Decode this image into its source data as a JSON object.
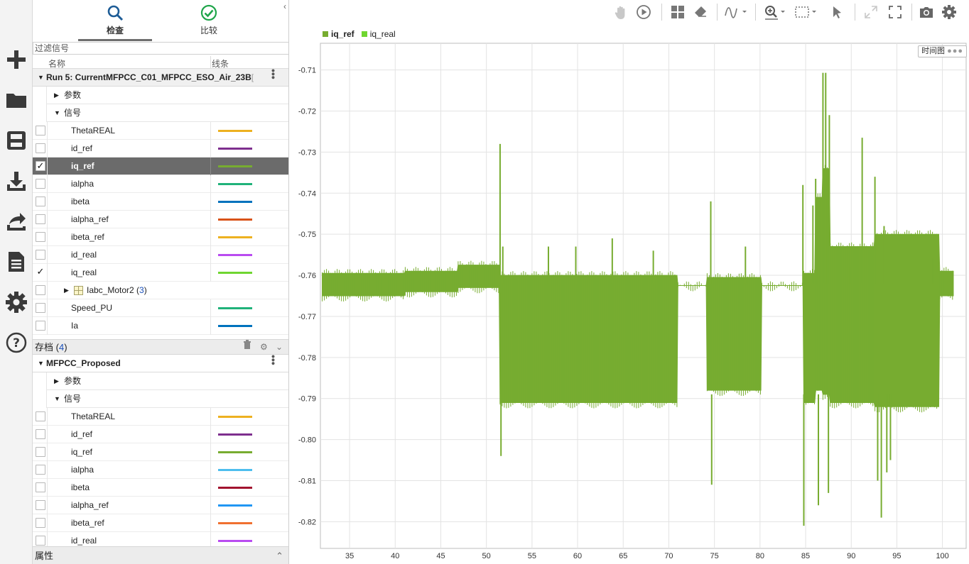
{
  "leftbar": {
    "items": [
      {
        "name": "new-icon"
      },
      {
        "name": "open-folder-icon"
      },
      {
        "name": "save-icon"
      },
      {
        "name": "import-icon"
      },
      {
        "name": "share-icon"
      },
      {
        "name": "report-icon"
      },
      {
        "name": "settings-icon"
      },
      {
        "name": "help-icon"
      }
    ]
  },
  "panel": {
    "tabs": [
      {
        "label": "检查",
        "icon": "search-icon",
        "active": true
      },
      {
        "label": "比较",
        "icon": "check-circle-icon",
        "active": false
      }
    ],
    "filter_placeholder": "过滤信号",
    "columns": {
      "name": "名称",
      "line": "线条"
    },
    "run1": {
      "name": "Run 5: CurrentMFPCC_C01_MFPCC_ESO_Air_23B",
      "name_fade": "[",
      "params_label": "参数",
      "signals_label": "信号",
      "signals": [
        {
          "name": "ThetaREAL",
          "color": "#EDB120",
          "checked": false
        },
        {
          "name": "id_ref",
          "color": "#7E2F8E",
          "checked": false
        },
        {
          "name": "iq_ref",
          "color": "#77AC30",
          "checked": true,
          "selected": true
        },
        {
          "name": "ialpha",
          "color": "#20B27A",
          "checked": false
        },
        {
          "name": "ibeta",
          "color": "#0072BD",
          "checked": false
        },
        {
          "name": "ialpha_ref",
          "color": "#D95319",
          "checked": false
        },
        {
          "name": "ibeta_ref",
          "color": "#EDB120",
          "checked": false
        },
        {
          "name": "id_real",
          "color": "#B94CF0",
          "checked": false
        },
        {
          "name": "iq_real",
          "color": "#6FD630",
          "checked": true
        },
        {
          "name": "Iabc_Motor2",
          "count": "3",
          "group": true
        },
        {
          "name": "Speed_PU",
          "color": "#20B27A",
          "checked": false
        },
        {
          "name": "Ia",
          "color": "#0072BD",
          "checked": false
        }
      ]
    },
    "archive": {
      "label": "存档",
      "count": "4"
    },
    "run2": {
      "name": "MFPCC_Proposed",
      "params_label": "参数",
      "signals_label": "信号",
      "signals": [
        {
          "name": "ThetaREAL",
          "color": "#EDB120"
        },
        {
          "name": "id_ref",
          "color": "#7E2F8E"
        },
        {
          "name": "iq_ref",
          "color": "#77AC30"
        },
        {
          "name": "ialpha",
          "color": "#4DBEEE"
        },
        {
          "name": "ibeta",
          "color": "#A2142F"
        },
        {
          "name": "ialpha_ref",
          "color": "#2196F3"
        },
        {
          "name": "ibeta_ref",
          "color": "#F07030"
        },
        {
          "name": "id_real",
          "color": "#B94CF0"
        }
      ]
    },
    "properties_label": "属性"
  },
  "legend": [
    {
      "name": "iq_ref",
      "color": "#77AC30",
      "active": true
    },
    {
      "name": "iq_real",
      "color": "#6FD630",
      "active": false
    }
  ],
  "timeplot_label": "时间图",
  "chart_data": {
    "type": "line",
    "title": "",
    "xlabel": "",
    "ylabel": "",
    "xlim": [
      31.8,
      102.6
    ],
    "ylim": [
      -0.8265,
      -0.7035
    ],
    "x_ticks": [
      35,
      40,
      45,
      50,
      55,
      60,
      65,
      70,
      75,
      80,
      85,
      90,
      95,
      100
    ],
    "y_ticks": [
      -0.71,
      -0.72,
      -0.73,
      -0.74,
      -0.75,
      -0.76,
      -0.77,
      -0.78,
      -0.79,
      -0.8,
      -0.81,
      -0.82
    ],
    "y_tick_labels": [
      "-0.71",
      "-0.72",
      "-0.73",
      "-0.74",
      "-0.75",
      "-0.76",
      "-0.77",
      "-0.78",
      "-0.79",
      "-0.80",
      "-0.81",
      "-0.82"
    ],
    "grid": true,
    "series": [
      {
        "name": "iq_ref",
        "color": "#77AC30",
        "envelope": {
          "x": [
            32.0,
            41.0,
            41.1,
            46.8,
            46.9,
            51.4,
            51.5,
            70.9,
            71.0,
            74.1,
            74.2,
            80.1,
            80.2,
            84.7,
            84.8,
            86.0,
            86.1,
            86.8,
            86.9,
            87.6,
            87.7,
            92.5,
            92.6,
            99.6,
            99.7,
            101.2
          ],
          "upper": [
            -0.7595,
            -0.7595,
            -0.759,
            -0.759,
            -0.7575,
            -0.7575,
            -0.76,
            -0.76,
            -0.7625,
            -0.7625,
            -0.7605,
            -0.7605,
            -0.7625,
            -0.7625,
            -0.7595,
            -0.7595,
            -0.741,
            -0.741,
            -0.734,
            -0.734,
            -0.753,
            -0.753,
            -0.75,
            -0.75,
            -0.759,
            -0.759
          ],
          "lower": [
            -0.765,
            -0.765,
            -0.764,
            -0.764,
            -0.763,
            -0.763,
            -0.791,
            -0.791,
            -0.7625,
            -0.7625,
            -0.788,
            -0.788,
            -0.7625,
            -0.7625,
            -0.791,
            -0.791,
            -0.788,
            -0.788,
            -0.789,
            -0.789,
            -0.791,
            -0.791,
            -0.792,
            -0.792,
            -0.765,
            -0.765
          ]
        },
        "spikes": [
          {
            "x": 51.5,
            "y": -0.728
          },
          {
            "x": 51.6,
            "y": -0.804
          },
          {
            "x": 51.8,
            "y": -0.753
          },
          {
            "x": 56.8,
            "y": -0.753
          },
          {
            "x": 59.8,
            "y": -0.753
          },
          {
            "x": 63.8,
            "y": -0.751
          },
          {
            "x": 68.3,
            "y": -0.754
          },
          {
            "x": 74.6,
            "y": -0.742
          },
          {
            "x": 74.7,
            "y": -0.811
          },
          {
            "x": 78.4,
            "y": -0.753
          },
          {
            "x": 84.7,
            "y": -0.738
          },
          {
            "x": 84.8,
            "y": -0.821
          },
          {
            "x": 85.8,
            "y": -0.743
          },
          {
            "x": 86.1,
            "y": -0.7365
          },
          {
            "x": 86.4,
            "y": -0.816
          },
          {
            "x": 86.9,
            "y": -0.7107
          },
          {
            "x": 87.2,
            "y": -0.7107
          },
          {
            "x": 87.5,
            "y": -0.813
          },
          {
            "x": 87.6,
            "y": -0.721
          },
          {
            "x": 89.9,
            "y": -0.758
          },
          {
            "x": 91.2,
            "y": -0.7265
          },
          {
            "x": 92.6,
            "y": -0.736
          },
          {
            "x": 92.9,
            "y": -0.81
          },
          {
            "x": 93.3,
            "y": -0.819
          },
          {
            "x": 93.6,
            "y": -0.748
          },
          {
            "x": 93.9,
            "y": -0.808
          },
          {
            "x": 94.3,
            "y": -0.805
          },
          {
            "x": 94.5,
            "y": -0.753
          },
          {
            "x": 99.0,
            "y": -0.756
          }
        ]
      }
    ]
  }
}
